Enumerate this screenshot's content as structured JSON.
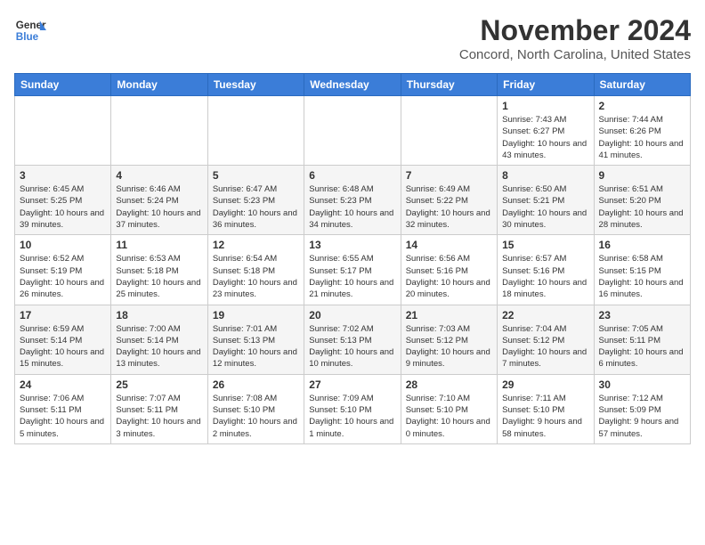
{
  "logo": {
    "general": "General",
    "blue": "Blue"
  },
  "title": "November 2024",
  "location": "Concord, North Carolina, United States",
  "headers": [
    "Sunday",
    "Monday",
    "Tuesday",
    "Wednesday",
    "Thursday",
    "Friday",
    "Saturday"
  ],
  "weeks": [
    [
      {
        "day": "",
        "info": ""
      },
      {
        "day": "",
        "info": ""
      },
      {
        "day": "",
        "info": ""
      },
      {
        "day": "",
        "info": ""
      },
      {
        "day": "",
        "info": ""
      },
      {
        "day": "1",
        "info": "Sunrise: 7:43 AM\nSunset: 6:27 PM\nDaylight: 10 hours and 43 minutes."
      },
      {
        "day": "2",
        "info": "Sunrise: 7:44 AM\nSunset: 6:26 PM\nDaylight: 10 hours and 41 minutes."
      }
    ],
    [
      {
        "day": "3",
        "info": "Sunrise: 6:45 AM\nSunset: 5:25 PM\nDaylight: 10 hours and 39 minutes."
      },
      {
        "day": "4",
        "info": "Sunrise: 6:46 AM\nSunset: 5:24 PM\nDaylight: 10 hours and 37 minutes."
      },
      {
        "day": "5",
        "info": "Sunrise: 6:47 AM\nSunset: 5:23 PM\nDaylight: 10 hours and 36 minutes."
      },
      {
        "day": "6",
        "info": "Sunrise: 6:48 AM\nSunset: 5:23 PM\nDaylight: 10 hours and 34 minutes."
      },
      {
        "day": "7",
        "info": "Sunrise: 6:49 AM\nSunset: 5:22 PM\nDaylight: 10 hours and 32 minutes."
      },
      {
        "day": "8",
        "info": "Sunrise: 6:50 AM\nSunset: 5:21 PM\nDaylight: 10 hours and 30 minutes."
      },
      {
        "day": "9",
        "info": "Sunrise: 6:51 AM\nSunset: 5:20 PM\nDaylight: 10 hours and 28 minutes."
      }
    ],
    [
      {
        "day": "10",
        "info": "Sunrise: 6:52 AM\nSunset: 5:19 PM\nDaylight: 10 hours and 26 minutes."
      },
      {
        "day": "11",
        "info": "Sunrise: 6:53 AM\nSunset: 5:18 PM\nDaylight: 10 hours and 25 minutes."
      },
      {
        "day": "12",
        "info": "Sunrise: 6:54 AM\nSunset: 5:18 PM\nDaylight: 10 hours and 23 minutes."
      },
      {
        "day": "13",
        "info": "Sunrise: 6:55 AM\nSunset: 5:17 PM\nDaylight: 10 hours and 21 minutes."
      },
      {
        "day": "14",
        "info": "Sunrise: 6:56 AM\nSunset: 5:16 PM\nDaylight: 10 hours and 20 minutes."
      },
      {
        "day": "15",
        "info": "Sunrise: 6:57 AM\nSunset: 5:16 PM\nDaylight: 10 hours and 18 minutes."
      },
      {
        "day": "16",
        "info": "Sunrise: 6:58 AM\nSunset: 5:15 PM\nDaylight: 10 hours and 16 minutes."
      }
    ],
    [
      {
        "day": "17",
        "info": "Sunrise: 6:59 AM\nSunset: 5:14 PM\nDaylight: 10 hours and 15 minutes."
      },
      {
        "day": "18",
        "info": "Sunrise: 7:00 AM\nSunset: 5:14 PM\nDaylight: 10 hours and 13 minutes."
      },
      {
        "day": "19",
        "info": "Sunrise: 7:01 AM\nSunset: 5:13 PM\nDaylight: 10 hours and 12 minutes."
      },
      {
        "day": "20",
        "info": "Sunrise: 7:02 AM\nSunset: 5:13 PM\nDaylight: 10 hours and 10 minutes."
      },
      {
        "day": "21",
        "info": "Sunrise: 7:03 AM\nSunset: 5:12 PM\nDaylight: 10 hours and 9 minutes."
      },
      {
        "day": "22",
        "info": "Sunrise: 7:04 AM\nSunset: 5:12 PM\nDaylight: 10 hours and 7 minutes."
      },
      {
        "day": "23",
        "info": "Sunrise: 7:05 AM\nSunset: 5:11 PM\nDaylight: 10 hours and 6 minutes."
      }
    ],
    [
      {
        "day": "24",
        "info": "Sunrise: 7:06 AM\nSunset: 5:11 PM\nDaylight: 10 hours and 5 minutes."
      },
      {
        "day": "25",
        "info": "Sunrise: 7:07 AM\nSunset: 5:11 PM\nDaylight: 10 hours and 3 minutes."
      },
      {
        "day": "26",
        "info": "Sunrise: 7:08 AM\nSunset: 5:10 PM\nDaylight: 10 hours and 2 minutes."
      },
      {
        "day": "27",
        "info": "Sunrise: 7:09 AM\nSunset: 5:10 PM\nDaylight: 10 hours and 1 minute."
      },
      {
        "day": "28",
        "info": "Sunrise: 7:10 AM\nSunset: 5:10 PM\nDaylight: 10 hours and 0 minutes."
      },
      {
        "day": "29",
        "info": "Sunrise: 7:11 AM\nSunset: 5:10 PM\nDaylight: 9 hours and 58 minutes."
      },
      {
        "day": "30",
        "info": "Sunrise: 7:12 AM\nSunset: 5:09 PM\nDaylight: 9 hours and 57 minutes."
      }
    ]
  ]
}
